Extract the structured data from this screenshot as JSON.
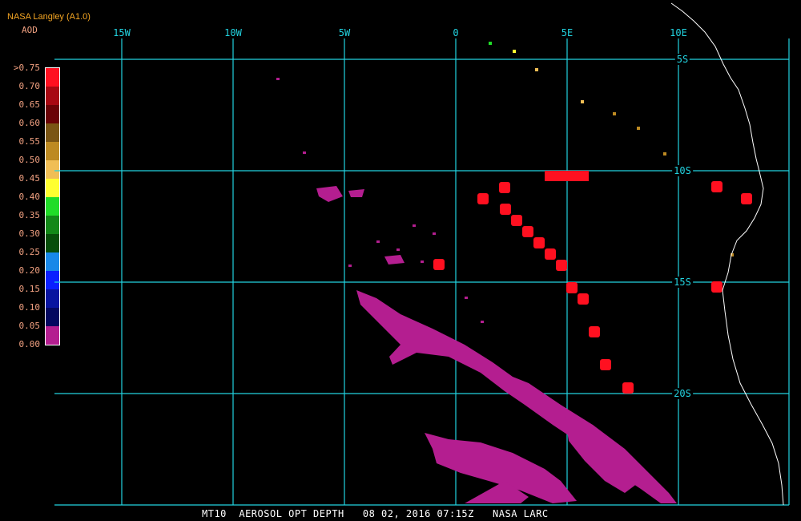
{
  "header": {
    "title": "NASA Langley (A1.0)",
    "legend_title": "AOD"
  },
  "legend": {
    "labels": [
      ">0.75",
      "0.70",
      "0.65",
      "0.60",
      "0.55",
      "0.50",
      "0.45",
      "0.40",
      "0.35",
      "0.30",
      "0.25",
      "0.20",
      "0.15",
      "0.10",
      "0.05",
      "0.00"
    ],
    "colors": [
      "#ff1020",
      "#a80812",
      "#6a0206",
      "#7a5514",
      "#bd8a22",
      "#f0be55",
      "#ffff30",
      "#20dc28",
      "#128818",
      "#064e0a",
      "#1888e8",
      "#0a20ff",
      "#0814a0",
      "#040860",
      "#b41e90"
    ]
  },
  "map": {
    "longitude_labels": [
      "15W",
      "10W",
      "5W",
      "0",
      "5E",
      "10E"
    ],
    "latitude_labels": [
      "5S",
      "10S",
      "15S",
      "20S"
    ],
    "grid_color": "#22d3e0",
    "coast_color": "#ffffff",
    "plume_color": "#b41e90",
    "high_aod_color": "#ff1020"
  },
  "caption": "MT10  AEROSOL OPT DEPTH   08 02, 2016 07:15Z   NASA LARC"
}
